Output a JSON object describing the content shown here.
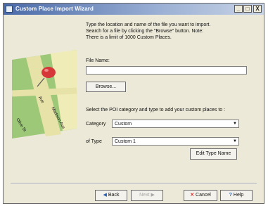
{
  "window": {
    "title": "Custom Place Import Wizard",
    "minimize": "_",
    "maximize": "□",
    "close": "X"
  },
  "intro": {
    "line1": "Type the location and name of the file you want to import.",
    "line2": "Search for a file by clicking the \"Browse\" button. Note:",
    "line3": "There is a limit of 1000 Custom Places."
  },
  "file": {
    "label": "File Name:",
    "value": "",
    "browse": "Browse..."
  },
  "poi": {
    "instruction": "Select the POI category and type to add your custom places to :",
    "category_label": "Category",
    "category_value": "Custom",
    "type_label": "of Type",
    "type_value": "Custom 1",
    "edit_button": "Edit Type Name"
  },
  "map": {
    "street1": "Ave",
    "street2": "Madison Ave",
    "street3": "Olive St"
  },
  "footer": {
    "back": "Back",
    "next": "Next",
    "cancel": "Cancel",
    "help": "Help"
  },
  "colors": {
    "title_bar": "#4a6aa8",
    "window_bg": "#ece9d8",
    "pin": "#d6383a",
    "map_green": "#9cc878",
    "map_cream": "#f0ecb8"
  }
}
